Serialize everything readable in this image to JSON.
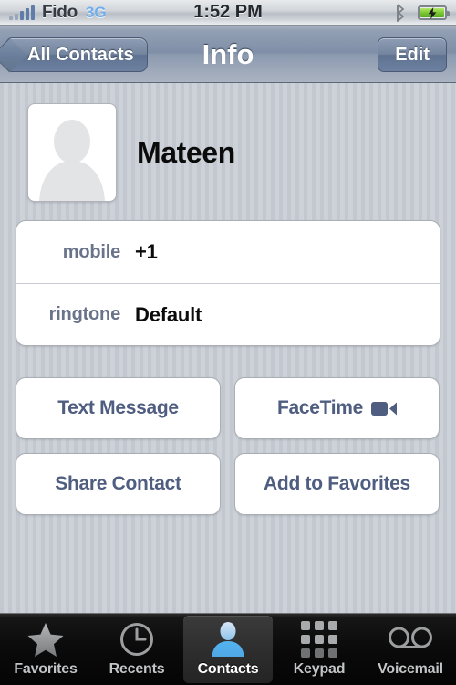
{
  "status_bar": {
    "signal_icon": "signal-bars-icon",
    "signal_bars_total": 5,
    "signal_bars_active": 5,
    "carrier": "Fido",
    "network": "3G",
    "network_color": "#6eaeee",
    "time": "1:52 PM",
    "bluetooth_icon": "bluetooth-icon",
    "battery_icon": "battery-charging-icon",
    "battery_charging": true,
    "battery_color": "#7cc832"
  },
  "nav_bar": {
    "back_label": "All Contacts",
    "back_icon": "chevron-left-icon",
    "title": "Info",
    "edit_label": "Edit"
  },
  "contact": {
    "photo_icon": "person-placeholder-icon",
    "name": "Mateen",
    "fields": [
      {
        "label": "mobile",
        "value": "+1"
      },
      {
        "label": "ringtone",
        "value": "Default"
      }
    ]
  },
  "actions": [
    {
      "label": "Text Message",
      "icon": null
    },
    {
      "label": "FaceTime",
      "icon": "video-camera-icon"
    },
    {
      "label": "Share Contact",
      "icon": null
    },
    {
      "label": "Add to Favorites",
      "icon": null
    }
  ],
  "accent": {
    "label_blue": "#69738a",
    "button_text_blue": "#4f5d80",
    "nav_blue": "#7f8fa7"
  },
  "tab_bar": {
    "items": [
      {
        "label": "Favorites",
        "icon": "star-icon",
        "selected": false
      },
      {
        "label": "Recents",
        "icon": "clock-icon",
        "selected": false
      },
      {
        "label": "Contacts",
        "icon": "person-icon",
        "selected": true
      },
      {
        "label": "Keypad",
        "icon": "keypad-grid-icon",
        "selected": false
      },
      {
        "label": "Voicemail",
        "icon": "voicemail-icon",
        "selected": false
      }
    ]
  }
}
